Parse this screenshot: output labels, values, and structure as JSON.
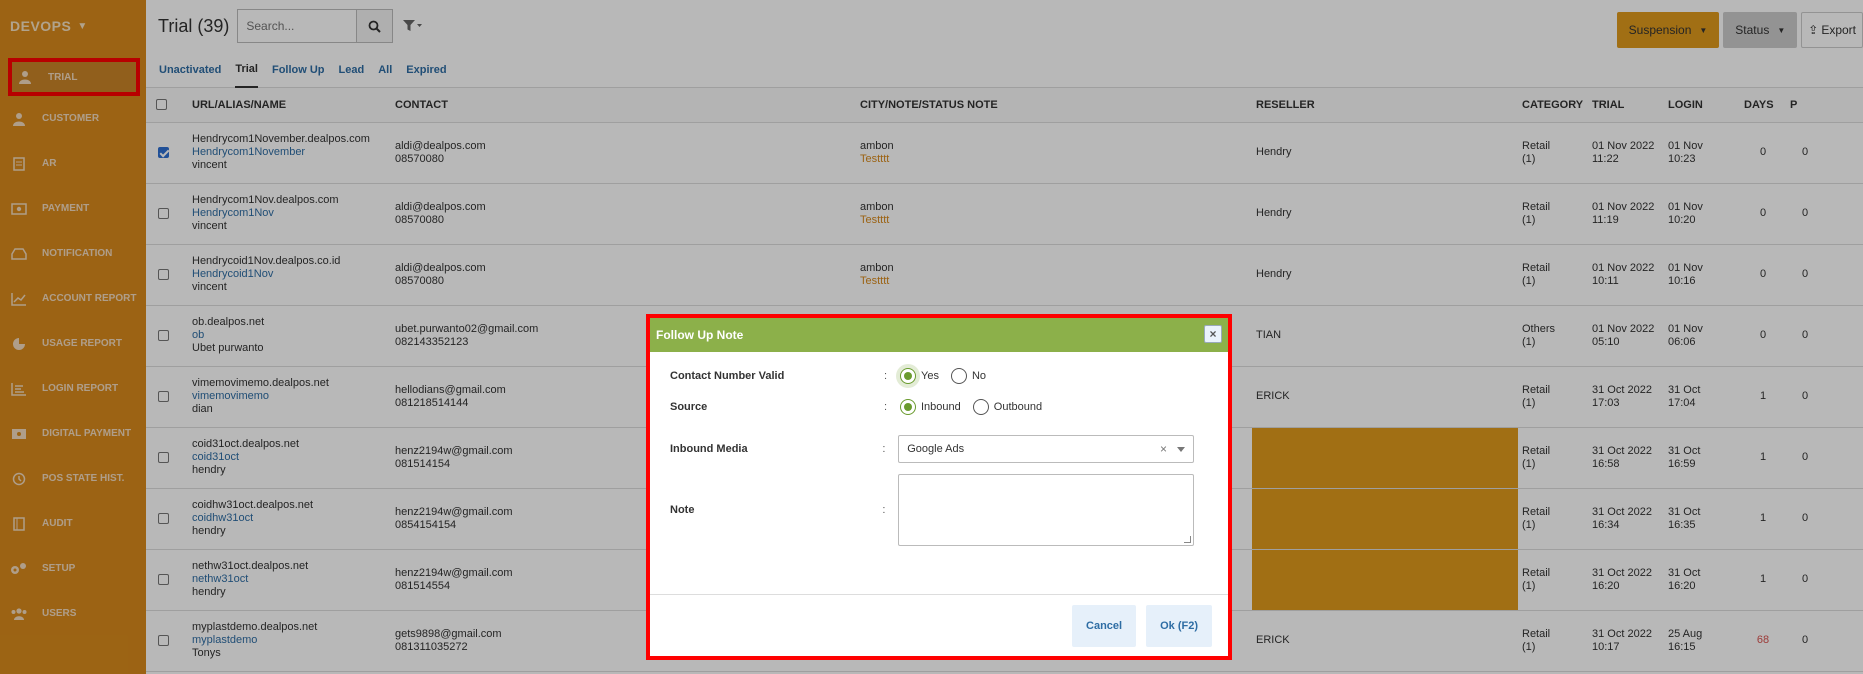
{
  "sidebar": {
    "brand": "DEVOPS",
    "items": [
      {
        "label": "TRIAL",
        "icon": "user-icon"
      },
      {
        "label": "CUSTOMER",
        "icon": "user-icon"
      },
      {
        "label": "AR",
        "icon": "document-icon"
      },
      {
        "label": "PAYMENT",
        "icon": "money-icon"
      },
      {
        "label": "NOTIFICATION",
        "icon": "inbox-icon"
      },
      {
        "label": "ACCOUNT REPORT",
        "icon": "line-chart-icon"
      },
      {
        "label": "USAGE REPORT",
        "icon": "pie-chart-icon"
      },
      {
        "label": "LOGIN REPORT",
        "icon": "list-chart-icon"
      },
      {
        "label": "DIGITAL PAYMENT",
        "icon": "card-money-icon"
      },
      {
        "label": "POS STATE HIST.",
        "icon": "history-icon"
      },
      {
        "label": "AUDIT",
        "icon": "book-icon"
      },
      {
        "label": "SETUP",
        "icon": "gears-icon"
      },
      {
        "label": "USERS",
        "icon": "users-icon"
      }
    ]
  },
  "header": {
    "title": "Trial (39)",
    "search_placeholder": "Search...",
    "suspension_label": "Suspension",
    "status_label": "Status",
    "export_label": "Export"
  },
  "tabs": [
    "Unactivated",
    "Trial",
    "Follow Up",
    "Lead",
    "All",
    "Expired"
  ],
  "table": {
    "columns": [
      "URL/ALIAS/NAME",
      "CONTACT",
      "CITY/NOTE/STATUS NOTE",
      "RESELLER",
      "CATEGORY",
      "TRIAL",
      "LOGIN",
      "DAYS",
      "P"
    ],
    "rows": [
      {
        "url": "Hendrycom1November.dealpos.com",
        "alias": "Hendrycom1November",
        "name": "vincent",
        "email": "aldi@dealpos.com",
        "phone": "08570080",
        "city": "ambon",
        "note": "Testttt",
        "reseller": "Hendry",
        "cat1": "Retail",
        "cat2": "(1)",
        "trial1": "01 Nov 2022",
        "trial2": "11:22",
        "login1": "01 Nov",
        "login2": "10:23",
        "days": "0",
        "p": "0",
        "checked": true
      },
      {
        "url": "Hendrycom1Nov.dealpos.com",
        "alias": "Hendrycom1Nov",
        "name": "vincent",
        "email": "aldi@dealpos.com",
        "phone": "08570080",
        "city": "ambon",
        "note": "Testttt",
        "reseller": "Hendry",
        "cat1": "Retail",
        "cat2": "(1)",
        "trial1": "01 Nov 2022",
        "trial2": "11:19",
        "login1": "01 Nov",
        "login2": "10:20",
        "days": "0",
        "p": "0"
      },
      {
        "url": "Hendrycoid1Nov.dealpos.co.id",
        "alias": "Hendrycoid1Nov",
        "name": "vincent",
        "email": "aldi@dealpos.com",
        "phone": "08570080",
        "city": "ambon",
        "note": "Testttt",
        "reseller": "Hendry",
        "cat1": "Retail",
        "cat2": "(1)",
        "trial1": "01 Nov 2022",
        "trial2": "10:11",
        "login1": "01 Nov",
        "login2": "10:16",
        "days": "0",
        "p": "0"
      },
      {
        "url": "ob.dealpos.net",
        "alias": "ob",
        "name": "Ubet purwanto",
        "email": "ubet.purwanto02@gmail.com",
        "phone": "082143352123",
        "city": "",
        "note": "",
        "reseller": "TIAN",
        "cat1": "Others",
        "cat2": "(1)",
        "trial1": "01 Nov 2022",
        "trial2": "05:10",
        "login1": "01 Nov",
        "login2": "06:06",
        "days": "0",
        "p": "0"
      },
      {
        "url": "vimemovimemo.dealpos.net",
        "alias": "vimemovimemo",
        "name": "dian",
        "email": "hellodians@gmail.com",
        "phone": "081218514144",
        "city": "",
        "note": "",
        "reseller": "ERICK",
        "cat1": "Retail",
        "cat2": "(1)",
        "trial1": "31 Oct 2022",
        "trial2": "17:03",
        "login1": "31 Oct",
        "login2": "17:04",
        "days": "1",
        "p": "0"
      },
      {
        "url": "coid31oct.dealpos.net",
        "alias": "coid31oct",
        "name": "hendry",
        "email": "henz2194w@gmail.com",
        "phone": "081514154",
        "city": "",
        "note": "",
        "reseller": "",
        "hl": true,
        "cat1": "Retail",
        "cat2": "(1)",
        "trial1": "31 Oct 2022",
        "trial2": "16:58",
        "login1": "31 Oct",
        "login2": "16:59",
        "days": "1",
        "p": "0"
      },
      {
        "url": "coidhw31oct.dealpos.net",
        "alias": "coidhw31oct",
        "name": "hendry",
        "email": "henz2194w@gmail.com",
        "phone": "0854154154",
        "city": "",
        "note": "",
        "reseller": "",
        "hl": true,
        "cat1": "Retail",
        "cat2": "(1)",
        "trial1": "31 Oct 2022",
        "trial2": "16:34",
        "login1": "31 Oct",
        "login2": "16:35",
        "days": "1",
        "p": "0"
      },
      {
        "url": "nethw31oct.dealpos.net",
        "alias": "nethw31oct",
        "name": "hendry",
        "email": "henz2194w@gmail.com",
        "phone": "081514554",
        "city": "",
        "note": "",
        "reseller": "",
        "hl": true,
        "cat1": "Retail",
        "cat2": "(1)",
        "trial1": "31 Oct 2022",
        "trial2": "16:20",
        "login1": "31 Oct",
        "login2": "16:20",
        "days": "1",
        "p": "0"
      },
      {
        "url": "myplastdemo.dealpos.net",
        "alias": "myplastdemo",
        "name": "Tonys",
        "email": "gets9898@gmail.com",
        "phone": "081311035272",
        "city": "",
        "note": "",
        "reseller": "ERICK",
        "cat1": "Retail",
        "cat2": "(1)",
        "trial1": "31 Oct 2022",
        "trial2": "10:17",
        "login1": "25 Aug",
        "login2": "16:15",
        "days": "68",
        "days_red": true,
        "p": "0"
      }
    ]
  },
  "modal": {
    "title": "Follow Up Note",
    "close": "×",
    "contact_label": "Contact Number Valid",
    "yes": "Yes",
    "no": "No",
    "source_label": "Source",
    "inbound": "Inbound",
    "outbound": "Outbound",
    "media_label": "Inbound Media",
    "media_value": "Google Ads",
    "note_label": "Note",
    "colon": ":",
    "cancel": "Cancel",
    "ok": "Ok (F2)"
  }
}
